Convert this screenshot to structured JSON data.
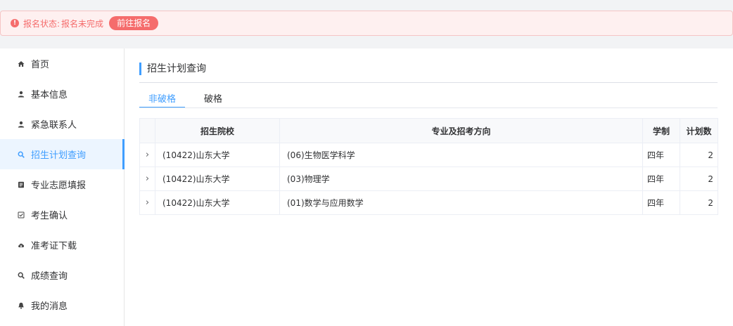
{
  "status": {
    "label": "报名状态:",
    "value": "报名未完成",
    "button": "前往报名",
    "icon": "alert-circle-icon",
    "color": "#f56c6c"
  },
  "sidebar": {
    "items": [
      {
        "label": "首页",
        "icon": "home-icon"
      },
      {
        "label": "基本信息",
        "icon": "user-icon"
      },
      {
        "label": "紧急联系人",
        "icon": "user-icon"
      },
      {
        "label": "招生计划查询",
        "icon": "search-icon",
        "active": true
      },
      {
        "label": "专业志愿填报",
        "icon": "form-icon"
      },
      {
        "label": "考生确认",
        "icon": "checkbox-icon"
      },
      {
        "label": "准考证下载",
        "icon": "cloud-download-icon"
      },
      {
        "label": "成绩查询",
        "icon": "search-icon"
      },
      {
        "label": "我的消息",
        "icon": "bell-icon"
      }
    ]
  },
  "main": {
    "title": "招生计划查询",
    "tabs": [
      {
        "label": "非破格",
        "active": true
      },
      {
        "label": "破格",
        "active": false
      }
    ],
    "table": {
      "headers": [
        "招生院校",
        "专业及招考方向",
        "学制",
        "计划数"
      ],
      "rows": [
        {
          "school": "(10422)山东大学",
          "major": "(06)生物医学科学",
          "duration": "四年",
          "count": "2"
        },
        {
          "school": "(10422)山东大学",
          "major": "(03)物理学",
          "duration": "四年",
          "count": "2"
        },
        {
          "school": "(10422)山东大学",
          "major": "(01)数学与应用数学",
          "duration": "四年",
          "count": "2"
        }
      ]
    }
  },
  "colors": {
    "accent": "#409eff",
    "danger": "#f56c6c",
    "active_bg": "#ecf5ff"
  }
}
